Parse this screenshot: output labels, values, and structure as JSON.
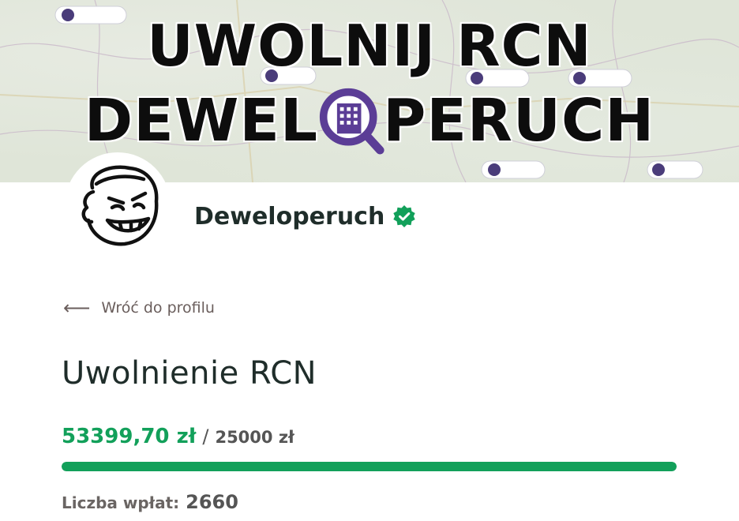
{
  "banner": {
    "line1": "UWOLNIJ RCN",
    "line2_left": "DEWEL",
    "line2_right": "PERUCH"
  },
  "profile": {
    "name": "Deweloperuch",
    "verified": true,
    "avatar_icon": "grinning-face-avatar"
  },
  "back_link": {
    "arrow": "⟵",
    "label": "Wróć do profilu"
  },
  "campaign": {
    "title": "Uwolnienie RCN",
    "raised": "53399,70 zł",
    "separator": "/",
    "goal": "25000 zł",
    "progress_fraction": 1.0,
    "donations_label": "Liczba wpłat:",
    "donations_count": "2660"
  },
  "colors": {
    "accent_green": "#12a05a",
    "brand_purple": "#5b3d96",
    "text_dark": "#1f2d2a"
  }
}
